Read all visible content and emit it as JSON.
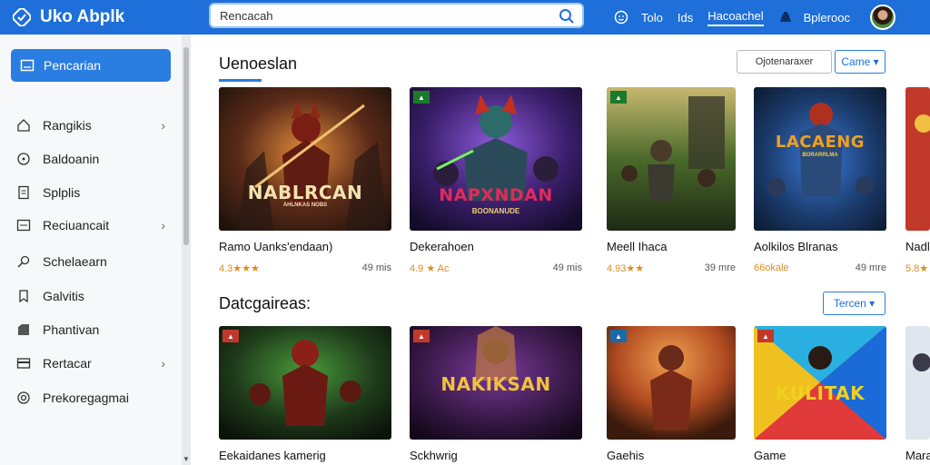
{
  "header": {
    "brand": "Uko Abplk",
    "search_placeholder": "Rencacah",
    "links": [
      "Tolo",
      "Ids",
      "Hacoachel",
      "Bplerooc"
    ]
  },
  "sidebar": {
    "active": "Pencarian",
    "items": [
      {
        "label": "Rangikis",
        "icon": "home-icon",
        "chevron": true
      },
      {
        "label": "Baldoanin",
        "icon": "clock-icon",
        "chevron": false
      },
      {
        "label": "Splplis",
        "icon": "document-icon",
        "chevron": false
      },
      {
        "label": "Reciuancait",
        "icon": "box-icon",
        "chevron": true
      },
      {
        "label": "Schelaearn",
        "icon": "search-icon",
        "chevron": false
      },
      {
        "label": "Galvitis",
        "icon": "bookmark-icon",
        "chevron": false
      },
      {
        "label": "Phantivan",
        "icon": "tag-icon",
        "chevron": false
      },
      {
        "label": "Rertacar",
        "icon": "card-icon",
        "chevron": true
      },
      {
        "label": "Prekoregagmai",
        "icon": "settings-icon",
        "chevron": false
      }
    ]
  },
  "section1": {
    "title": "Uenoeslan",
    "filter": "Ojotenaraxer",
    "dropdown": "Came ▾",
    "cards": [
      {
        "title": "Ramo Uanks'endaan)",
        "rating": "4.3★★★",
        "size": "49 mis",
        "logo": "NABLRCAN",
        "sub": "AHLNKAS NOBS"
      },
      {
        "title": "Dekerahoen",
        "rating": "4.9 ★ Ac",
        "size": "49 mis",
        "logo": "NAPXNDAN",
        "sub": "BOONANUDE"
      },
      {
        "title": "Meell Ihaca",
        "rating": "4.93★★",
        "size": "39 mre",
        "logo": "",
        "sub": ""
      },
      {
        "title": "Aolkilos Blranas",
        "rating": "66okale",
        "size": "49 mre",
        "logo": "LACAENG",
        "sub": "BORARRLMA"
      },
      {
        "title": "Nadl",
        "rating": "5.8★",
        "size": "",
        "logo": "",
        "sub": ""
      }
    ]
  },
  "section2": {
    "title": "Datcgaireas:",
    "dropdown": "Tercen ▾",
    "cards": [
      {
        "title": "Eekaidanes kamerig",
        "logo": "",
        "sub": ""
      },
      {
        "title": "Sckhwrig",
        "logo": "NAKIKSAN",
        "sub": ""
      },
      {
        "title": "Gaehis",
        "logo": "",
        "sub": ""
      },
      {
        "title": "Game",
        "logo": "KULITAK",
        "sub": ""
      },
      {
        "title": "Mara",
        "logo": "",
        "sub": ""
      }
    ]
  },
  "colors": {
    "topbar": "#1e6fd9",
    "accent": "#2a7de1",
    "rating": "#e08a1e"
  }
}
